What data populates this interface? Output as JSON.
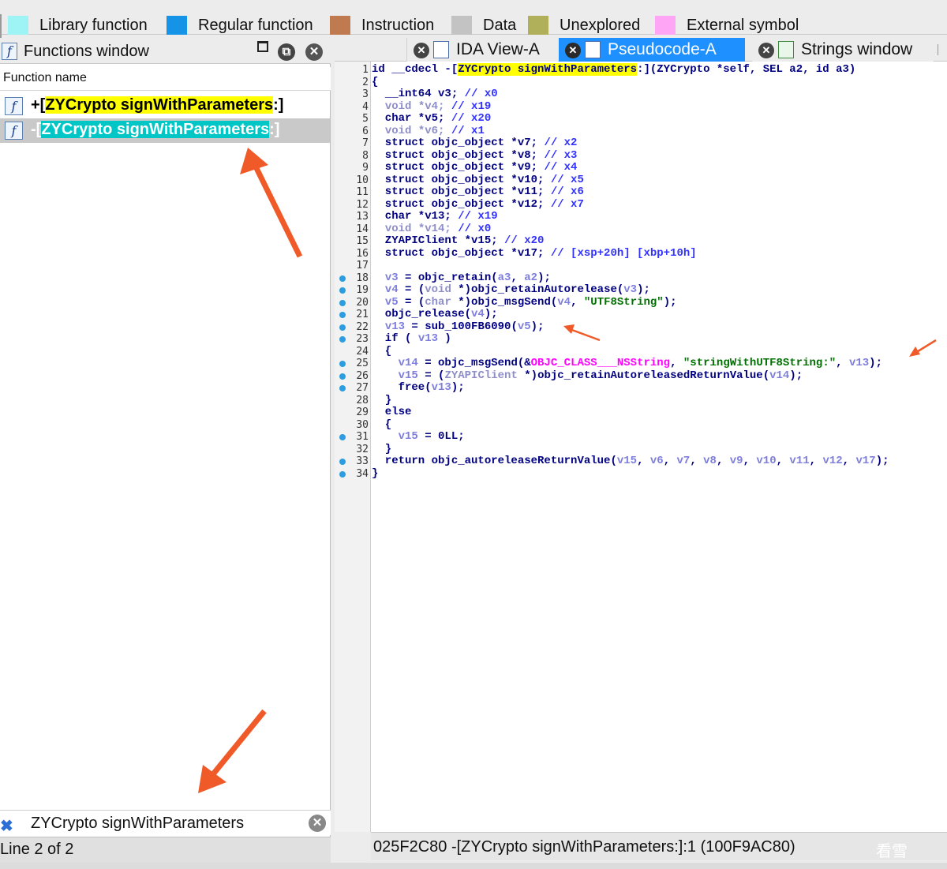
{
  "legend": {
    "items": [
      {
        "label": "Library function",
        "color": "#9ef4f4"
      },
      {
        "label": "Regular function",
        "color": "#1593e6"
      },
      {
        "label": "Instruction",
        "color": "#c07a50"
      },
      {
        "label": "Data",
        "color": "#c3c3c3"
      },
      {
        "label": "Unexplored",
        "color": "#b0b05a"
      },
      {
        "label": "External symbol",
        "color": "#ffa5f6"
      }
    ]
  },
  "functions_window": {
    "title": "Functions window",
    "icon": "function-icon",
    "column_header": "Function name",
    "rows": [
      {
        "prefix": "+[",
        "name": "ZYCrypto signWithParameters",
        "suffix": ":]"
      },
      {
        "prefix": "-[",
        "name": "ZYCrypto signWithParameters",
        "suffix": ":]"
      }
    ],
    "search_value": "ZYCrypto signWithParameters",
    "status": "Line 2 of 2"
  },
  "tabs": [
    {
      "label": "IDA View-A",
      "active": false
    },
    {
      "label": "Pseudocode-A",
      "active": true
    },
    {
      "label": "Strings window",
      "active": false
    }
  ],
  "code_lines": [
    {
      "n": "1",
      "dot": false,
      "html": "id __cdecl -[<span class=\"hly\">ZYCrypto signWithParameters</span>:](ZYCrypto *self, SEL a2, id a3)"
    },
    {
      "n": "2",
      "dot": false,
      "html": "{"
    },
    {
      "n": "3",
      "dot": false,
      "html": "  __int64 v3; <span class=\"cm\">// x0</span>"
    },
    {
      "n": "4",
      "dot": false,
      "html": "  <span class=\"cmg\">void *v4;</span> <span class=\"cm\">// x19</span>"
    },
    {
      "n": "5",
      "dot": false,
      "html": "  char *v5; <span class=\"cm\">// x20</span>"
    },
    {
      "n": "6",
      "dot": false,
      "html": "  <span class=\"cmg\">void *v6;</span> <span class=\"cm\">// x1</span>"
    },
    {
      "n": "7",
      "dot": false,
      "html": "  struct objc_object *v7; <span class=\"cm\">// x2</span>"
    },
    {
      "n": "8",
      "dot": false,
      "html": "  struct objc_object *v8; <span class=\"cm\">// x3</span>"
    },
    {
      "n": "9",
      "dot": false,
      "html": "  struct objc_object *v9; <span class=\"cm\">// x4</span>"
    },
    {
      "n": "10",
      "dot": false,
      "html": "  struct objc_object *v10; <span class=\"cm\">// x5</span>"
    },
    {
      "n": "11",
      "dot": false,
      "html": "  struct objc_object *v11; <span class=\"cm\">// x6</span>"
    },
    {
      "n": "12",
      "dot": false,
      "html": "  struct objc_object *v12; <span class=\"cm\">// x7</span>"
    },
    {
      "n": "13",
      "dot": false,
      "html": "  char *v13; <span class=\"cm\">// x19</span>"
    },
    {
      "n": "14",
      "dot": false,
      "html": "  <span class=\"cmg\">void *v14;</span> <span class=\"cm\">// x0</span>"
    },
    {
      "n": "15",
      "dot": false,
      "html": "  ZYAPIClient *v15; <span class=\"cm\">// x20</span>"
    },
    {
      "n": "16",
      "dot": false,
      "html": "  struct objc_object *v17; <span class=\"cm\">// [xsp+20h] [xbp+10h]</span>"
    },
    {
      "n": "17",
      "dot": false,
      "html": ""
    },
    {
      "n": "18",
      "dot": true,
      "html": "  <span class=\"var\">v3</span> = objc_retain(<span class=\"var\">a3</span>, <span class=\"var\">a2</span>);"
    },
    {
      "n": "19",
      "dot": true,
      "html": "  <span class=\"var\">v4</span> = (<span class=\"cmg\">void</span> *)objc_retainAutorelease(<span class=\"var\">v3</span>);"
    },
    {
      "n": "20",
      "dot": true,
      "html": "  <span class=\"var\">v5</span> = (<span class=\"cmg\">char</span> *)objc_msgSend(<span class=\"var\">v4</span>, <span class=\"str\">\"UTF8String\"</span>);"
    },
    {
      "n": "21",
      "dot": true,
      "html": "  objc_release(<span class=\"var\">v4</span>);"
    },
    {
      "n": "22",
      "dot": true,
      "html": "  <span class=\"var\">v13</span> = sub_100FB6090(<span class=\"var\">v5</span>);"
    },
    {
      "n": "23",
      "dot": true,
      "html": "  if ( <span class=\"var\">v13</span> )"
    },
    {
      "n": "24",
      "dot": false,
      "html": "  {"
    },
    {
      "n": "25",
      "dot": true,
      "html": "    <span class=\"var\">v14</span> = objc_msgSend(&amp;<span class=\"cls\">OBJC_CLASS___NSString</span>, <span class=\"str\">\"stringWithUTF8String:\"</span>, <span class=\"var\">v13</span>);"
    },
    {
      "n": "26",
      "dot": true,
      "html": "    <span class=\"var\">v15</span> = (<span class=\"cmg\">ZYAPIClient</span> *)objc_retainAutoreleasedReturnValue(<span class=\"var\">v14</span>);"
    },
    {
      "n": "27",
      "dot": true,
      "html": "    free(<span class=\"var\">v13</span>);"
    },
    {
      "n": "28",
      "dot": false,
      "html": "  }"
    },
    {
      "n": "29",
      "dot": false,
      "html": "  else"
    },
    {
      "n": "30",
      "dot": false,
      "html": "  {"
    },
    {
      "n": "31",
      "dot": true,
      "html": "    <span class=\"var\">v15</span> = 0LL;"
    },
    {
      "n": "32",
      "dot": false,
      "html": "  }"
    },
    {
      "n": "33",
      "dot": true,
      "html": "  return objc_autoreleaseReturnValue(<span class=\"var\">v15</span>, <span class=\"var\">v6</span>, <span class=\"var\">v7</span>, <span class=\"var\">v8</span>, <span class=\"var\">v9</span>, <span class=\"var\">v10</span>, <span class=\"var\">v11</span>, <span class=\"var\">v12</span>, <span class=\"var\">v17</span>);"
    },
    {
      "n": "34",
      "dot": true,
      "html": "}"
    }
  ],
  "code_status": "025F2C80  -[ZYCrypto signWithParameters:]:1 (100F9AC80)",
  "watermark": "看雪",
  "annotation_color": "#f05a28"
}
